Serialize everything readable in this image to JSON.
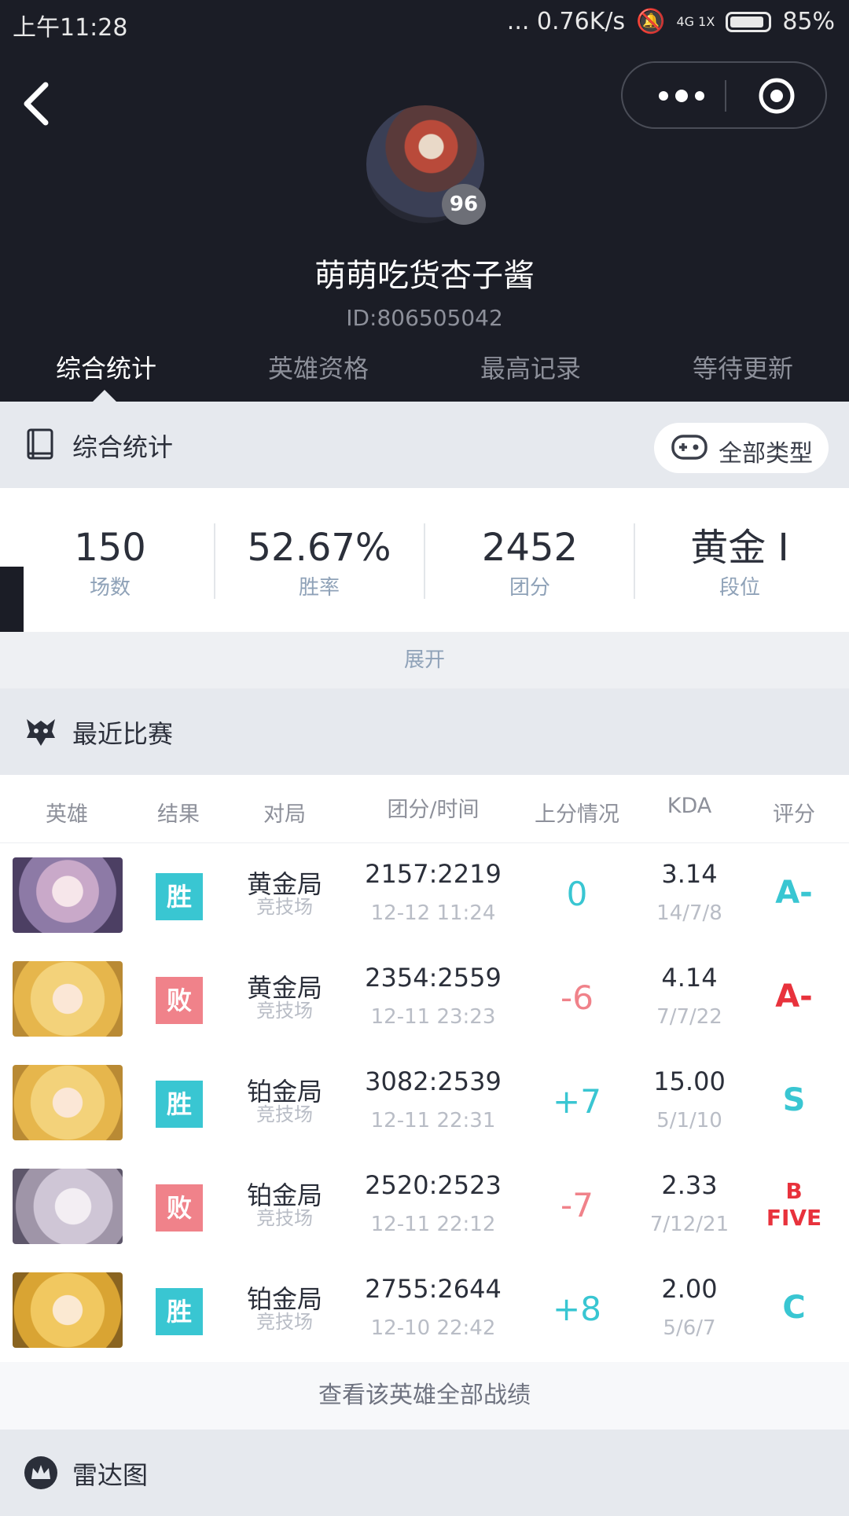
{
  "status_bar": {
    "time": "上午11:28",
    "speed": "... 0.76K/s",
    "network": "4G 1X",
    "battery": "85%"
  },
  "profile": {
    "level": "96",
    "nickname": "萌萌吃货杏子酱",
    "id": "ID:806505042"
  },
  "tabs": [
    "综合统计",
    "英雄资格",
    "最高记录",
    "等待更新"
  ],
  "stats_section": {
    "title": "综合统计",
    "filter_label": "全部类型",
    "items": [
      {
        "value": "150",
        "label": "场数"
      },
      {
        "value": "52.67%",
        "label": "胜率"
      },
      {
        "value": "2452",
        "label": "团分"
      },
      {
        "value": "黄金 I",
        "label": "段位"
      }
    ],
    "expand_label": "展开"
  },
  "recent": {
    "title": "最近比赛",
    "headers": [
      "英雄",
      "结果",
      "对局",
      "团分/时间",
      "上分情况",
      "KDA",
      "评分"
    ],
    "rows": [
      {
        "result": "胜",
        "match": "黄金局",
        "mode": "竞技场",
        "score": "2157:2219",
        "time": "12-12 11:24",
        "delta": "0",
        "kda": "3.14",
        "kda_detail": "14/7/8",
        "grade": "A-",
        "grade2": ""
      },
      {
        "result": "败",
        "match": "黄金局",
        "mode": "竞技场",
        "score": "2354:2559",
        "time": "12-11 23:23",
        "delta": "-6",
        "kda": "4.14",
        "kda_detail": "7/7/22",
        "grade": "A-",
        "grade2": ""
      },
      {
        "result": "胜",
        "match": "铂金局",
        "mode": "竞技场",
        "score": "3082:2539",
        "time": "12-11 22:31",
        "delta": "+7",
        "kda": "15.00",
        "kda_detail": "5/1/10",
        "grade": "S",
        "grade2": ""
      },
      {
        "result": "败",
        "match": "铂金局",
        "mode": "竞技场",
        "score": "2520:2523",
        "time": "12-11 22:12",
        "delta": "-7",
        "kda": "2.33",
        "kda_detail": "7/12/21",
        "grade": "B",
        "grade2": "FIVE"
      },
      {
        "result": "胜",
        "match": "铂金局",
        "mode": "竞技场",
        "score": "2755:2644",
        "time": "12-10 22:42",
        "delta": "+8",
        "kda": "2.00",
        "kda_detail": "5/6/7",
        "grade": "C",
        "grade2": ""
      }
    ],
    "view_all": "查看该英雄全部战绩"
  },
  "radar": {
    "title": "雷达图"
  },
  "colors": {
    "header_bg": "#1b1d26",
    "win": "#39c6d2",
    "lose": "#f0828a",
    "grade_red": "#e8323c"
  },
  "icons": [
    "back-arrow-icon",
    "more-dots-icon",
    "target-icon",
    "book-icon",
    "gamepad-icon",
    "demon-icon",
    "crown-icon"
  ]
}
